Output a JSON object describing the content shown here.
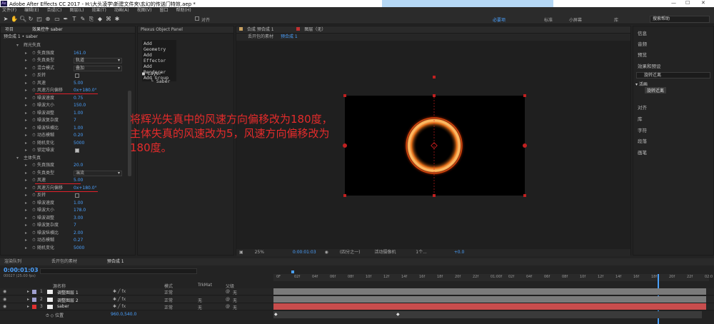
{
  "window": {
    "title": "Adobe After Effects CC 2017 - H:\\大头凌学\\新建文件夹\\玄幻的传送门特效.aep *",
    "logo": "Ae"
  },
  "menu": [
    "文件(F)",
    "编辑(E)",
    "合成(C)",
    "图层(L)",
    "效果(T)",
    "动画(A)",
    "视图(V)",
    "窗口",
    "帮助(H)"
  ],
  "toolbar": {
    "align_label": "对齐",
    "workspaces": [
      "必要项",
      "标准",
      "小屏幕",
      "库"
    ],
    "search_placeholder": "搜索帮助"
  },
  "project_tab": {
    "project": "项目",
    "effects_control": "效果控件 saber",
    "breadcrumb": "预合成 1 • saber"
  },
  "effect_rows": [
    {
      "name": "辉光失真",
      "indent": 1,
      "kind": "group"
    },
    {
      "name": "失真强度",
      "val": "161.0",
      "kind": "num"
    },
    {
      "name": "失真类型",
      "val": "轨道",
      "kind": "dd"
    },
    {
      "name": "混合模式",
      "val": "叠加",
      "kind": "dd"
    },
    {
      "name": "反转",
      "kind": "cb"
    },
    {
      "name": "风速",
      "val": "5.00",
      "kind": "num"
    },
    {
      "name": "风速方向偏移",
      "val": "0x+180.0°",
      "kind": "num",
      "hl": true
    },
    {
      "name": "噪波速度",
      "val": "0.75",
      "kind": "num"
    },
    {
      "name": "噪波大小",
      "val": "150.0",
      "kind": "num"
    },
    {
      "name": "噪波调整",
      "val": "1.00",
      "kind": "num"
    },
    {
      "name": "噪波复杂度",
      "val": "7",
      "kind": "num"
    },
    {
      "name": "噪波纵横比",
      "val": "1.00",
      "kind": "num"
    },
    {
      "name": "动态模糊",
      "val": "0.20",
      "kind": "num"
    },
    {
      "name": "随机变化",
      "val": "5000",
      "kind": "num"
    },
    {
      "name": "锁定噪波",
      "kind": "cbc"
    },
    {
      "name": "主体失真",
      "indent": 1,
      "kind": "group"
    },
    {
      "name": "失真强度",
      "val": "20.0",
      "kind": "num"
    },
    {
      "name": "失真类型",
      "val": "湍流",
      "kind": "dd"
    },
    {
      "name": "风速",
      "val": "5.00",
      "kind": "num",
      "hl2": true
    },
    {
      "name": "风速方向偏移",
      "val": "0x+180.0°",
      "kind": "num",
      "hl": true
    },
    {
      "name": "反转",
      "kind": "cb"
    },
    {
      "name": "噪波速度",
      "val": "1.00",
      "kind": "num"
    },
    {
      "name": "噪波大小",
      "val": "178.0",
      "kind": "num"
    },
    {
      "name": "噪波调整",
      "val": "3.00",
      "kind": "num"
    },
    {
      "name": "噪波复杂度",
      "val": "7",
      "kind": "num"
    },
    {
      "name": "噪波纵横比",
      "val": "2.00",
      "kind": "num"
    },
    {
      "name": "动态模糊",
      "val": "0.27",
      "kind": "num"
    },
    {
      "name": "随机变化",
      "val": "5000",
      "kind": "num"
    }
  ],
  "plexus": {
    "tab": "Plexus Object Panel",
    "items": [
      "Add Geometry",
      "Add Effector",
      "Add Renderer",
      "Add Group"
    ],
    "tree_root": "Layer",
    "tree_child": "Saber"
  },
  "comp": {
    "tab_comp": "合成 预合成 1",
    "tab_layer": "图层（无）",
    "breadcrumb1": "丢开包的素材",
    "breadcrumb2": "预合成 1",
    "zoom": "25%",
    "timecode": "0:00:01:03",
    "quality": "(四分之一)",
    "camera": "活动摄像机",
    "views": "1个...",
    "exposure": "+0.0"
  },
  "annotation": [
    "将辉光失真中的风速方向偏移改为180度，",
    "主体失真的风速改为5，风速方向偏移改为",
    "180度。"
  ],
  "right_panel": {
    "items": [
      "信息",
      "音频",
      "预览",
      "效果和预设",
      "对齐",
      "库",
      "字符",
      "段落",
      "画笔"
    ],
    "search_value": "旋转迁离",
    "tree_group": "▾ 活画",
    "tree_item": "旋转迁离"
  },
  "timeline": {
    "tabs": [
      "渲染队列",
      "丢开包的素材",
      "预合成 1"
    ],
    "timecode": "0:00:01:03",
    "fps": "00027 (25.00 fps)",
    "col_layername": "源名称",
    "col_mode": "模式",
    "col_trkmat": "TrkMat",
    "col_parent": "父级",
    "layers": [
      {
        "num": "1",
        "name": "调整图层 1",
        "mode": "正常",
        "trk": "",
        "parent": "无",
        "color": "#a0a0d0",
        "bar": "#7a7a7a"
      },
      {
        "num": "2",
        "name": "调整图层 2",
        "mode": "正常",
        "trk": "无",
        "parent": "无",
        "color": "#a0a0d0",
        "bar": "#7a7a7a"
      },
      {
        "num": "3",
        "name": "saber",
        "mode": "正常",
        "trk": "无",
        "parent": "无",
        "color": "#e03030",
        "bar": "#c84d4d"
      }
    ],
    "sub_prop": "位置",
    "sub_value": "960.0,540.0",
    "ticks": [
      "0F",
      "02f",
      "04f",
      "06f",
      "08f",
      "10f",
      "12f",
      "14f",
      "16f",
      "18f",
      "20f",
      "22f",
      "01:00f",
      "02f",
      "04f",
      "06f",
      "08f",
      "10f",
      "12f",
      "14f",
      "16f",
      "18f",
      "20f",
      "22f",
      "02:0"
    ]
  }
}
